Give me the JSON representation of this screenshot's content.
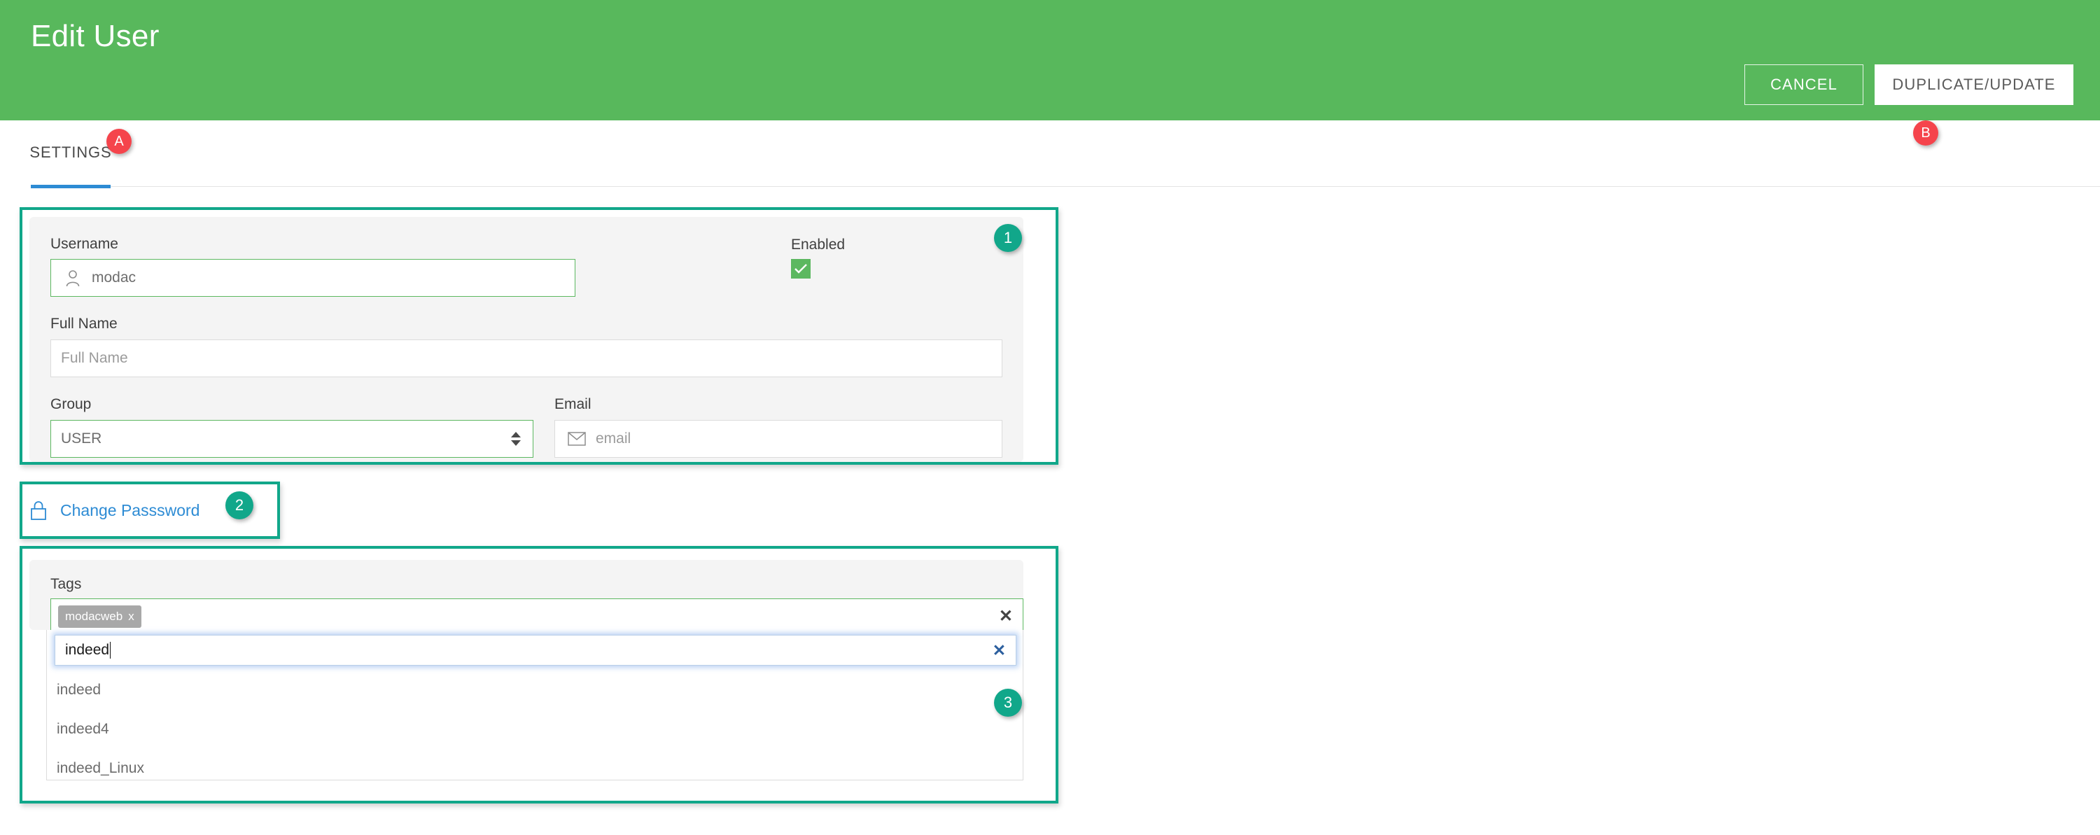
{
  "header": {
    "title": "Edit User",
    "cancel_label": "CANCEL",
    "primary_label": "DUPLICATE/UPDATE"
  },
  "tabs": [
    {
      "label": "SETTINGS",
      "active": true
    }
  ],
  "settings": {
    "username": {
      "label": "Username",
      "value": "modac",
      "icon": "user-icon"
    },
    "full_name": {
      "label": "Full Name",
      "value": "",
      "placeholder": "Full Name"
    },
    "group": {
      "label": "Group",
      "value": "USER",
      "options": [
        "USER"
      ]
    },
    "email": {
      "label": "Email",
      "value": "",
      "placeholder": "email",
      "icon": "envelope-icon"
    },
    "enabled": {
      "label": "Enabled",
      "checked": true,
      "check_color": "#5cb860"
    }
  },
  "change_password": {
    "label": "Change Passsword",
    "icon": "lock-icon",
    "color": "#2d8bd4"
  },
  "tags": {
    "label": "Tags",
    "chips": [
      {
        "text": "modacweb",
        "remove": "x"
      }
    ],
    "clear_icon": "close-icon",
    "input_value": "indeed",
    "input_clear_icon": "close-icon",
    "suggestions": [
      "indeed",
      "indeed4",
      "indeed_Linux"
    ]
  },
  "annotations": {
    "colors": {
      "teal": "#11a78a",
      "red": "#f5444c",
      "header_green": "#58b85c",
      "tab_blue": "#2d8bd4"
    },
    "badges": [
      {
        "id": "A",
        "kind": "red"
      },
      {
        "id": "B",
        "kind": "red"
      },
      {
        "id": "1",
        "kind": "teal"
      },
      {
        "id": "2",
        "kind": "teal"
      },
      {
        "id": "3",
        "kind": "teal"
      }
    ]
  }
}
